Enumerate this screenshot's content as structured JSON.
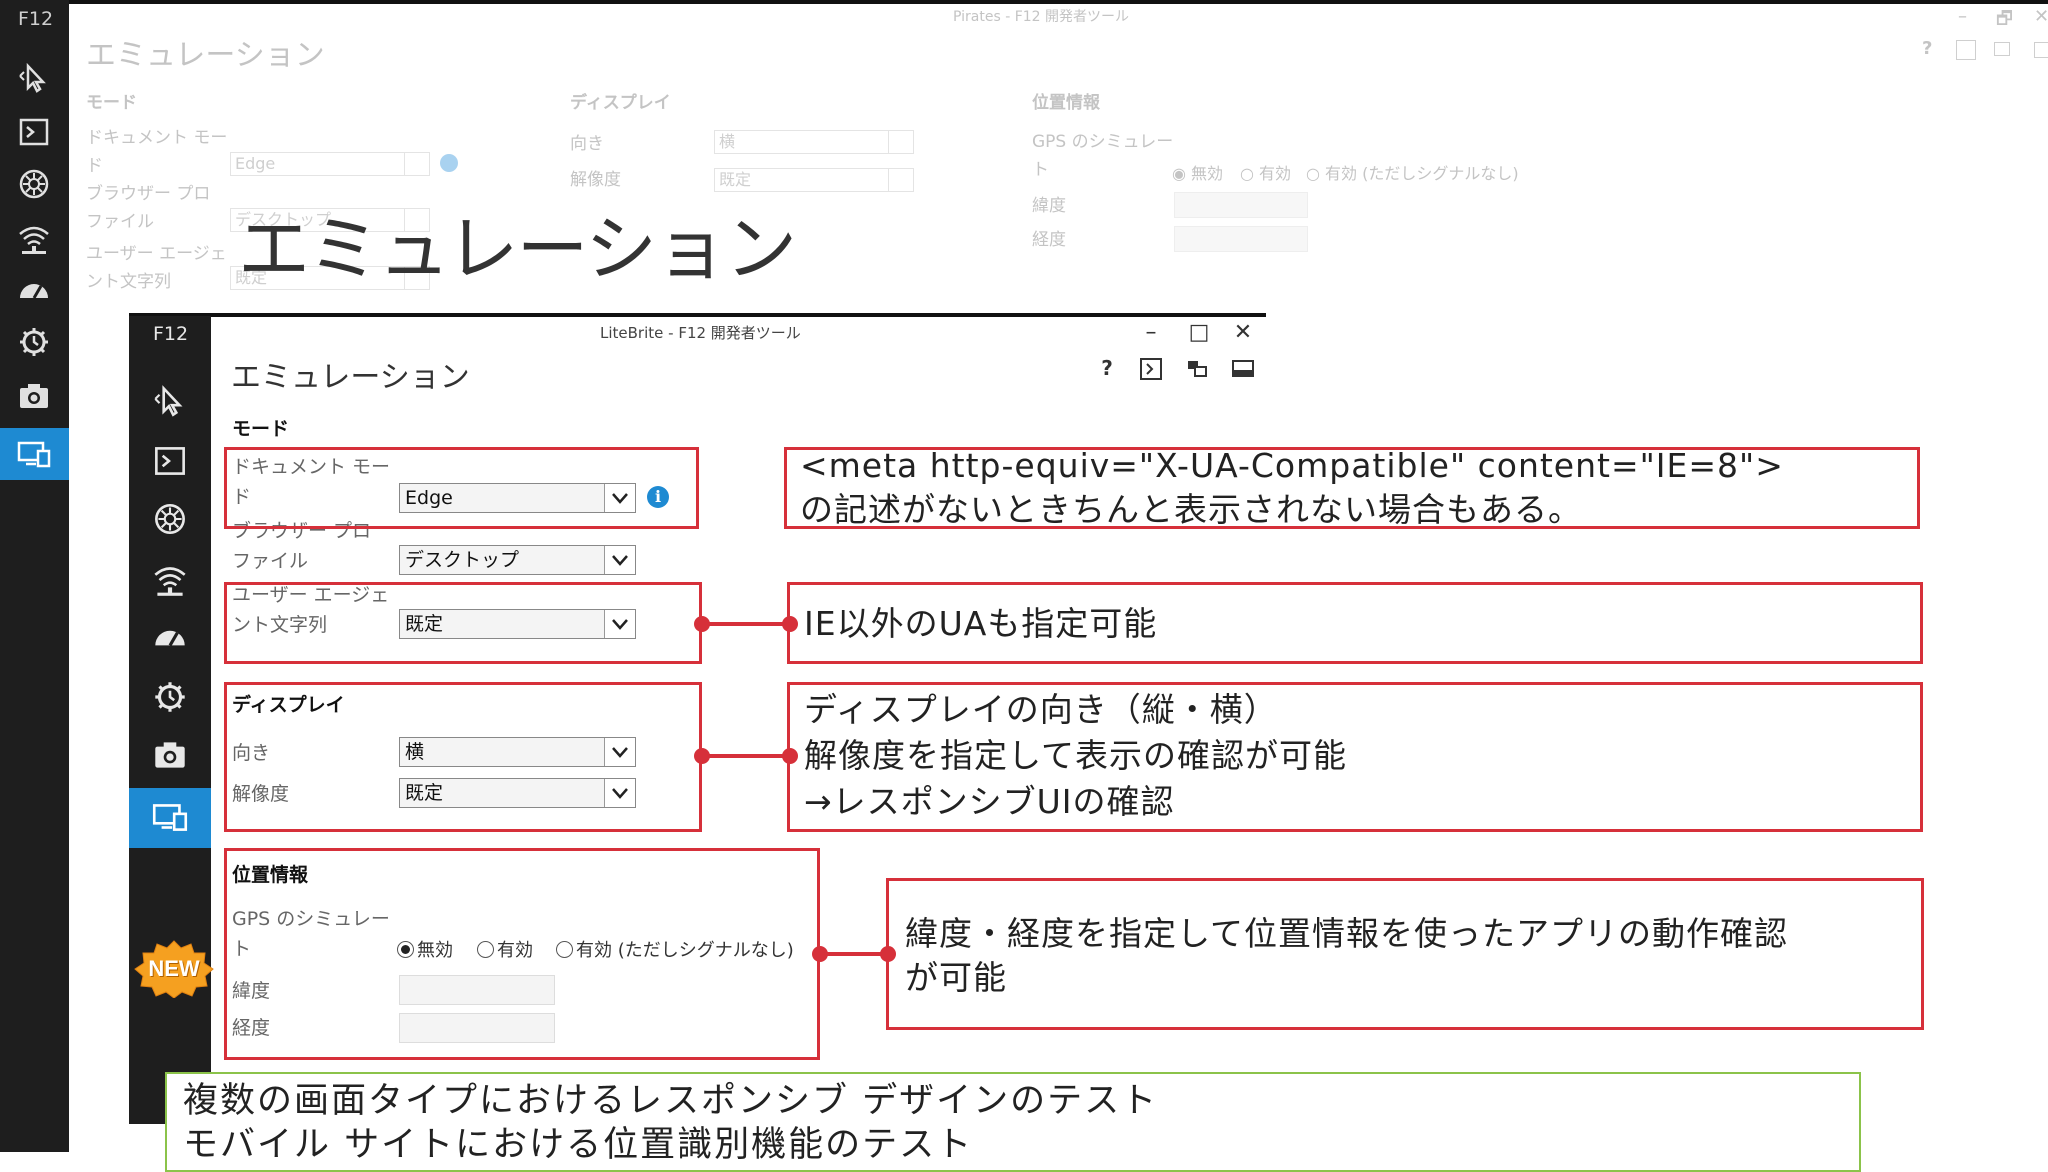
{
  "background_window": {
    "sidebar_title": "F12",
    "caption": "Pirates - F12 開発者ツール",
    "title": "エミュレーション",
    "mode": {
      "heading": "モード",
      "doc_mode_label_1": "ドキュメント モー",
      "doc_mode_label_2": "ド",
      "doc_mode_value": "Edge",
      "browser_profile_label_1": "ブラウザー プロ",
      "browser_profile_label_2": "ファイル",
      "browser_profile_value": "デスクトップ",
      "ua_label_1": "ユーザー エージェ",
      "ua_label_2": "ント文字列",
      "ua_value": "既定"
    },
    "display": {
      "heading": "ディスプレイ",
      "orientation_label": "向き",
      "orientation_value": "横",
      "resolution_label": "解像度",
      "resolution_value": "既定"
    },
    "geo": {
      "heading": "位置情報",
      "gps_label_1": "GPS のシミュレー",
      "gps_label_2": "ト",
      "opt_off": "無効",
      "opt_on": "有効",
      "opt_on_nosignal": "有効 (ただしシグナルなし)",
      "lat_label": "緯度",
      "lon_label": "経度"
    },
    "window_controls": {
      "minimize": "–",
      "restore": "🗗",
      "close": "✕"
    },
    "toolbar": {
      "help": "?"
    }
  },
  "overlay_title": "エミュレーション",
  "window": {
    "sidebar_title": "F12",
    "caption": "LiteBrite - F12 開発者ツール",
    "title": "エミュレーション",
    "window_controls": {
      "minimize": "–",
      "maximize": "□",
      "close": "✕"
    },
    "toolbar": {
      "help": "?"
    },
    "mode": {
      "heading": "モード",
      "doc_mode_label_1": "ドキュメント モー",
      "doc_mode_label_2": "ド",
      "doc_mode_value": "Edge",
      "browser_profile_label_1": "ブラウザー プロ",
      "browser_profile_label_2": "ファイル",
      "browser_profile_value": "デスクトップ",
      "ua_label_1": "ユーザー エージェ",
      "ua_label_2": "ント文字列",
      "ua_value": "既定"
    },
    "display": {
      "heading": "ディスプレイ",
      "orientation_label": "向き",
      "orientation_value": "横",
      "resolution_label": "解像度",
      "resolution_value": "既定"
    },
    "geo": {
      "heading": "位置情報",
      "gps_label_1": "GPS のシミュレー",
      "gps_label_2": "ト",
      "opt_off": "無効",
      "opt_on": "有効",
      "opt_on_nosignal": "有効 (ただしシグナルなし)",
      "lat_label": "緯度",
      "lon_label": "経度"
    }
  },
  "annotations": {
    "doc_mode_note_1": "<meta http-equiv=\"X-UA-Compatible\" content=\"IE=8\">",
    "doc_mode_note_2": "の記述がないときちんと表示されない場合もある。",
    "ua_note": "IE以外のUAも指定可能",
    "display_note_1": "ディスプレイの向き（縦・横）",
    "display_note_2": "解像度を指定して表示の確認が可能",
    "display_note_3": "→レスポンシブUIの確認",
    "geo_note_1": "緯度・経度を指定して位置情報を使ったアプリの動作確認",
    "geo_note_2": "が可能",
    "new_badge": "NEW",
    "summary_1": "複数の画面タイプにおけるレスポンシブ デザインのテスト",
    "summary_2": "モバイル サイトにおける位置識別機能のテスト"
  },
  "colors": {
    "sidebar": "#1e1e1e",
    "accent": "#1e8ad2",
    "annotation_red": "#d6303a",
    "summary_green": "#8bc34a",
    "badge_orange": "#f5a020"
  },
  "icons": [
    "cursor-icon",
    "console-icon",
    "debugger-icon",
    "network-icon",
    "performance-icon",
    "memory-icon",
    "screenshot-icon",
    "emulation-icon",
    "help-icon",
    "console-toggle-icon",
    "detach-icon",
    "dock-icon"
  ]
}
